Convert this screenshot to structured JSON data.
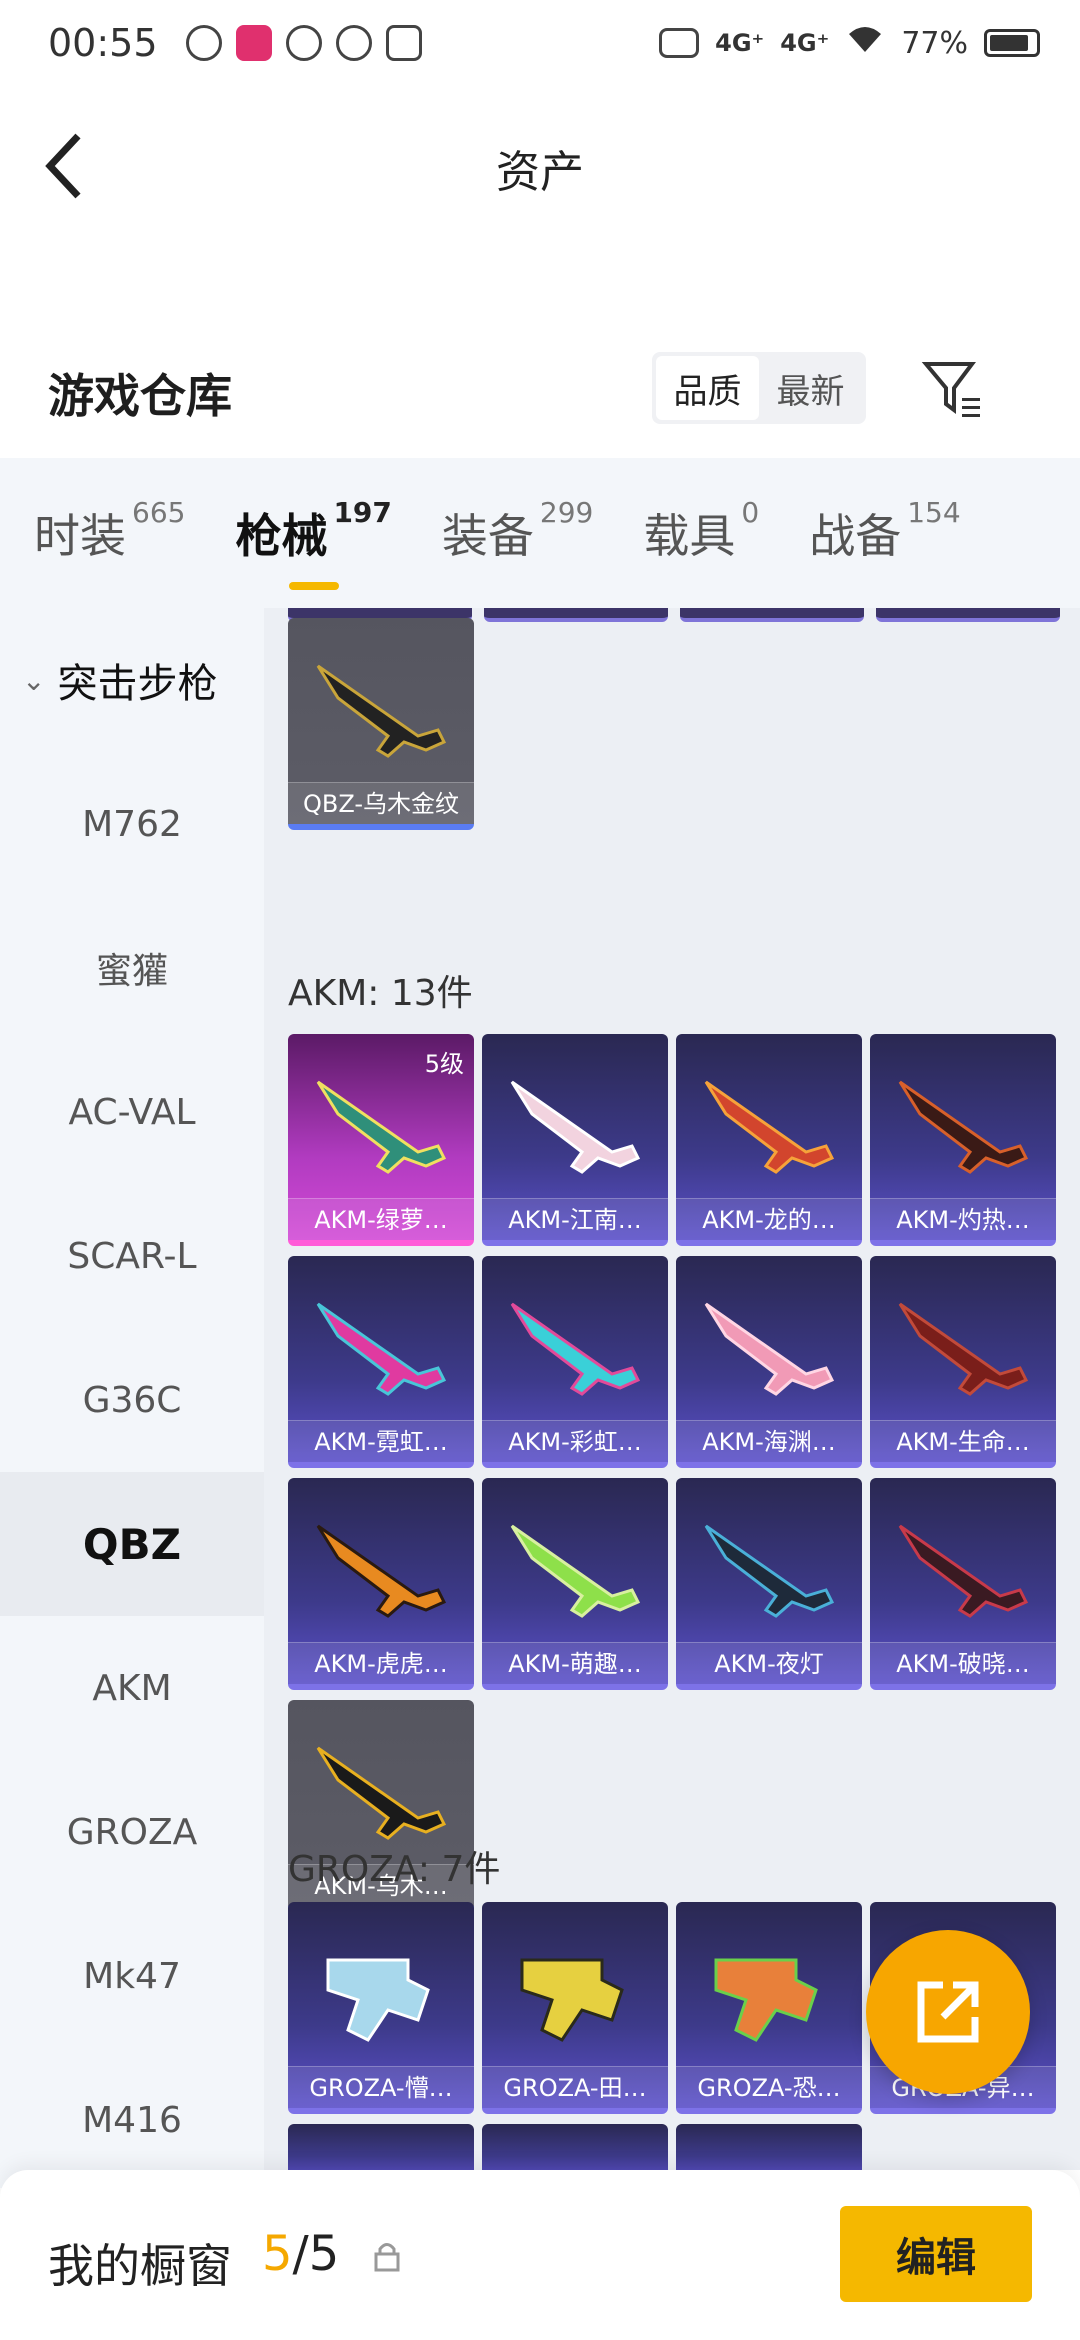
{
  "status_bar": {
    "time": "00:55",
    "signal1": "4G⁺",
    "signal2": "4G⁺",
    "battery": "77%"
  },
  "header": {
    "title": "资产"
  },
  "warehouse": {
    "title": "游戏仓库",
    "sort_quality": "品质",
    "sort_newest": "最新"
  },
  "tabs": [
    {
      "label": "时装",
      "count": "665"
    },
    {
      "label": "枪械",
      "count": "197"
    },
    {
      "label": "装备",
      "count": "299"
    },
    {
      "label": "载具",
      "count": "0"
    },
    {
      "label": "战备",
      "count": "154"
    }
  ],
  "sidebar": {
    "group": "突击步枪",
    "items": [
      "M762",
      "蜜獾",
      "AC-VAL",
      "SCAR-L",
      "G36C",
      "QBZ",
      "AKM",
      "GROZA",
      "Mk47",
      "M416"
    ]
  },
  "sections": {
    "qbz_cards": [
      "QBZ-乌木金纹"
    ],
    "akm_title": "AKM: 13件",
    "akm_level": "5级",
    "akm_cards": [
      "AKM-绿萝…",
      "AKM-江南…",
      "AKM-龙的…",
      "AKM-灼热…",
      "AKM-霓虹…",
      "AKM-彩虹…",
      "AKM-海渊…",
      "AKM-生命…",
      "AKM-虎虎…",
      "AKM-萌趣…",
      "AKM-夜灯",
      "AKM-破晓…",
      "AKM-乌木…"
    ],
    "groza_title": "GROZA: 7件",
    "groza_cards": [
      "GROZA-懵…",
      "GROZA-田…",
      "GROZA-恐…",
      "GROZA-异…"
    ]
  },
  "bottom_bar": {
    "title": "我的橱窗",
    "count_used": "5",
    "count_total": "/5",
    "edit_label": "编辑"
  }
}
